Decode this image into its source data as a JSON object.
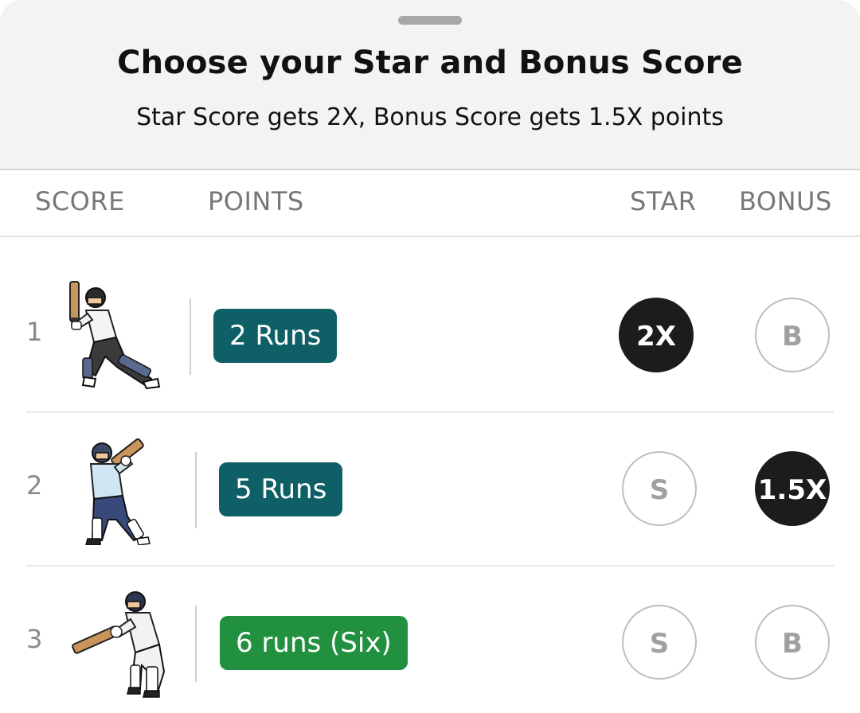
{
  "header": {
    "title": "Choose your Star and Bonus Score",
    "subtitle": "Star Score gets 2X, Bonus Score gets 1.5X points"
  },
  "columns": {
    "score": "SCORE",
    "points": "POINTS",
    "star": "STAR",
    "bonus": "BONUS"
  },
  "rows": [
    {
      "index": "1",
      "points": "2 Runs",
      "points_color": "#0e5f66",
      "star": "2X",
      "star_selected": true,
      "bonus": "B",
      "bonus_selected": false
    },
    {
      "index": "2",
      "points": "5 Runs",
      "points_color": "#0e5f66",
      "star": "S",
      "star_selected": false,
      "bonus": "1.5X",
      "bonus_selected": true
    },
    {
      "index": "3",
      "points": "6 runs (Six)",
      "points_color": "#21913f",
      "star": "S",
      "star_selected": false,
      "bonus": "B",
      "bonus_selected": false
    }
  ],
  "colors": {
    "selected": "#1c1c1c",
    "teal": "#0e5f66",
    "green": "#21913f"
  },
  "icons": [
    "cricket-batsman-icon"
  ]
}
